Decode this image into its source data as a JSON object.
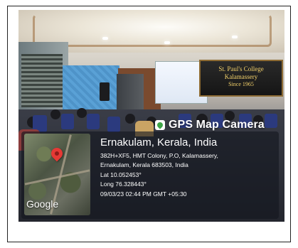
{
  "scene": {
    "banner": {
      "line1": "St. Paul's College",
      "line2": "Kalamassery",
      "line3": "Since 1965"
    }
  },
  "overlay": {
    "app_name": "GPS Map Camera",
    "map_label": "Google",
    "location_title": "Ernakulam, Kerala, India",
    "address_line1": "382H+XF5, HMT Colony, P.O, Kalamassery,",
    "address_line2": "Ernakulam, Kerala 683503, India",
    "latitude": "Lat 10.052453°",
    "longitude": "Long 76.328443°",
    "timestamp": "09/03/23 02:44 PM GMT +05:30"
  },
  "colors": {
    "pin": "#e53935",
    "badge_icon": "#3ea447",
    "banner_text": "#f2d06a"
  }
}
